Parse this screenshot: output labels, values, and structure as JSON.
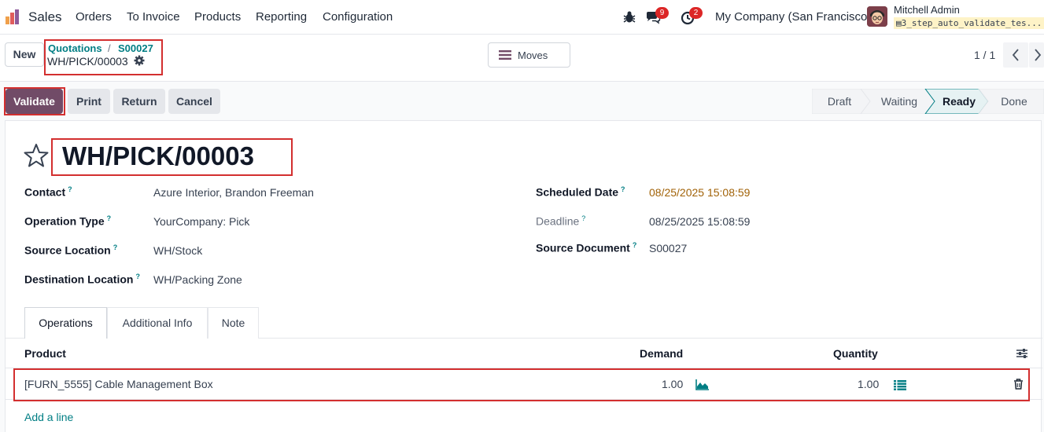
{
  "navbar": {
    "app_name": "Sales",
    "menu": [
      "Orders",
      "To Invoice",
      "Products",
      "Reporting",
      "Configuration"
    ],
    "messages_count": "9",
    "activities_count": "2",
    "company": "My Company (San Francisco)",
    "user_name": "Mitchell Admin",
    "database": "3_step_auto_validate_tes..."
  },
  "control": {
    "new_label": "New",
    "breadcrumb": [
      "Quotations",
      "S00027"
    ],
    "breadcrumb_sep": "/",
    "current_record": "WH/PICK/00003",
    "moves_label": "Moves",
    "pager": "1 / 1"
  },
  "actions": {
    "validate": "Validate",
    "print": "Print",
    "return": "Return",
    "cancel": "Cancel"
  },
  "status": {
    "stages": [
      "Draft",
      "Waiting",
      "Ready",
      "Done"
    ],
    "current": "Ready"
  },
  "record": {
    "title": "WH/PICK/00003",
    "fields_left": [
      {
        "label": "Contact",
        "value": "Azure Interior, Brandon Freeman"
      },
      {
        "label": "Operation Type",
        "value": "YourCompany: Pick"
      },
      {
        "label": "Source Location",
        "value": "WH/Stock"
      },
      {
        "label": "Destination Location",
        "value": "WH/Packing Zone"
      }
    ],
    "fields_right": [
      {
        "label": "Scheduled Date",
        "value": "08/25/2025 15:08:59"
      },
      {
        "label": "Deadline",
        "value": "08/25/2025 15:08:59"
      },
      {
        "label": "Source Document",
        "value": "S00027"
      }
    ],
    "help_mark": "?"
  },
  "tabs": [
    "Operations",
    "Additional Info",
    "Note"
  ],
  "table": {
    "columns": [
      "Product",
      "Demand",
      "Quantity"
    ],
    "rows": [
      {
        "product": "[FURN_5555] Cable Management Box",
        "demand": "1.00",
        "quantity": "1.00"
      }
    ],
    "add_line": "Add a line"
  },
  "colors": {
    "brand": "#714b67",
    "link": "#017e84",
    "highlight": "#d32f2f"
  }
}
